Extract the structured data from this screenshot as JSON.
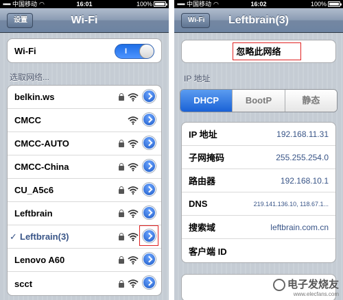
{
  "left": {
    "status": {
      "carrier": "中国移动",
      "time": "16:01",
      "battery": "100%"
    },
    "nav": {
      "back_label": "设置",
      "title": "Wi-Fi"
    },
    "wifi_toggle": {
      "label": "Wi-Fi",
      "on_label": "I"
    },
    "choose_network_label": "选取网络...",
    "networks": [
      {
        "name": "belkin.ws",
        "locked": true,
        "selected": false
      },
      {
        "name": "CMCC",
        "locked": false,
        "selected": false
      },
      {
        "name": "CMCC-AUTO",
        "locked": true,
        "selected": false
      },
      {
        "name": "CMCC-China",
        "locked": true,
        "selected": false
      },
      {
        "name": "CU_A5c6",
        "locked": true,
        "selected": false
      },
      {
        "name": "Leftbrain",
        "locked": true,
        "selected": false
      },
      {
        "name": "Leftbrain(3)",
        "locked": true,
        "selected": true,
        "checkmark": "✓"
      },
      {
        "name": "Lenovo A60",
        "locked": true,
        "selected": false
      },
      {
        "name": "scct",
        "locked": true,
        "selected": false
      }
    ]
  },
  "right": {
    "status": {
      "carrier": "中国移动",
      "time": "16:02",
      "battery": "100%"
    },
    "nav": {
      "back_label": "Wi-Fi",
      "title": "Leftbrain(3)"
    },
    "forget_button": "忽略此网络",
    "ip_section_label": "IP 地址",
    "segments": [
      {
        "label": "DHCP",
        "selected": true
      },
      {
        "label": "BootP",
        "selected": false
      },
      {
        "label": "静态",
        "selected": false
      }
    ],
    "info": [
      {
        "label": "IP 地址",
        "value": "192.168.11.31"
      },
      {
        "label": "子网掩码",
        "value": "255.255.254.0"
      },
      {
        "label": "路由器",
        "value": "192.168.10.1"
      },
      {
        "label": "DNS",
        "value": "219.141.136.10, 118.67.1..."
      },
      {
        "label": "搜索域",
        "value": "leftbrain.com.cn"
      },
      {
        "label": "客户端 ID",
        "value": ""
      }
    ]
  },
  "watermark": {
    "main": "电子发烧友",
    "url": "www.elecfans.com"
  },
  "colors": {
    "accent": "#1f5cc8",
    "highlight_border": "#e02020",
    "value_text": "#385487"
  }
}
